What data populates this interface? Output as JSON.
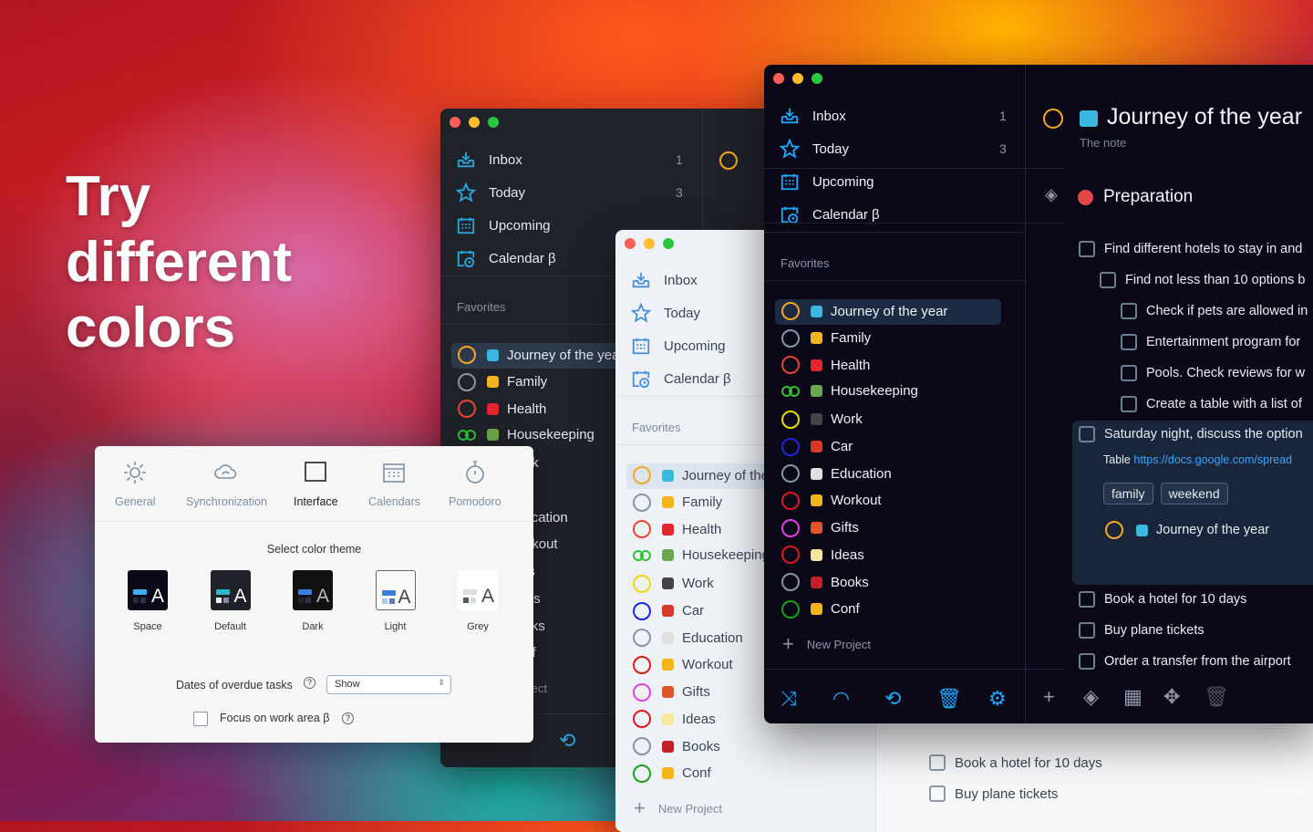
{
  "hero": {
    "line1": "Try",
    "line2": "different",
    "line3": "colors"
  },
  "nav": [
    {
      "label": "Inbox",
      "count": "1",
      "icon": "inbox-icon"
    },
    {
      "label": "Today",
      "count": "3",
      "icon": "star-icon"
    },
    {
      "label": "Upcoming",
      "count": "",
      "icon": "calendar-grid-icon"
    },
    {
      "label": "Calendar β",
      "count": "",
      "icon": "calendar-clock-icon"
    }
  ],
  "favorites_label": "Favorites",
  "new_project_label": "New Project",
  "projects": [
    {
      "name": "Journey of the year",
      "ring": "#f5a623",
      "emoji_color": "#3bb8e0"
    },
    {
      "name": "Family",
      "ring": "#8596a5",
      "emoji_color": "#f2b51f"
    },
    {
      "name": "Health",
      "ring": "#e8442f",
      "emoji_color": "#e4262e"
    },
    {
      "name": "Housekeeping",
      "ring": "#2fc42f",
      "double": true,
      "emoji_color": "#6aa84f"
    },
    {
      "name": "Work",
      "ring": "#e6dc00",
      "emoji_color": "#444"
    },
    {
      "name": "Car",
      "ring": "#1c24e6",
      "emoji_color": "#d83a2a"
    },
    {
      "name": "Education",
      "ring": "#8596a5",
      "emoji_color": "#e0e0e0"
    },
    {
      "name": "Workout",
      "ring": "#e01818",
      "emoji_color": "#f2b51f"
    },
    {
      "name": "Gifts",
      "ring": "#e33fe0",
      "emoji_color": "#e0562a"
    },
    {
      "name": "Ideas",
      "ring": "#e01818",
      "emoji_color": "#f5e6a0"
    },
    {
      "name": "Books",
      "ring": "#8596a5",
      "emoji_color": "#c2202a"
    },
    {
      "name": "Conf",
      "ring": "#18a018",
      "emoji_color": "#f2b51f"
    }
  ],
  "back_window": {
    "visible_partial": [
      "rk",
      "cation",
      "rkout",
      "s",
      "as",
      "oks",
      "nf",
      "oject"
    ]
  },
  "detail": {
    "project_title": "Journey of the year",
    "note": "The note",
    "heading": "Preparation",
    "tasks": [
      {
        "text": "Find different hotels to stay in and",
        "level": 0
      },
      {
        "text": "Find not less than 10 options b",
        "level": 1
      },
      {
        "text": "Check if pets are allowed in",
        "level": 2
      },
      {
        "text": "Entertainment program for",
        "level": 2
      },
      {
        "text": "Pools. Check reviews for w",
        "level": 2
      },
      {
        "text": "Create a table with a list of",
        "level": 2
      }
    ],
    "expanded_task": {
      "text": "Saturday night, discuss the option",
      "note_prefix": "Table",
      "link": "https://docs.google.com/spread",
      "tags": [
        "family",
        "weekend"
      ],
      "project": "Journey of the year"
    },
    "tasks_after": [
      "Book a hotel for 10 days",
      "Buy plane tickets",
      "Order a transfer from the airport"
    ]
  },
  "light_window": {
    "tasks": [
      "Book a hotel for 10 days",
      "Buy plane tickets"
    ]
  },
  "settings": {
    "tabs": [
      "General",
      "Synchronization",
      "Interface",
      "Calendars",
      "Pomodoro"
    ],
    "active_tab": "Interface",
    "section_title": "Select color theme",
    "themes": [
      "Space",
      "Default",
      "Dark",
      "Light",
      "Grey"
    ],
    "overdue_label": "Dates of overdue tasks",
    "overdue_value": "Show",
    "focus_label": "Focus on work area β"
  },
  "colors": {
    "space_bg": "#0b0818",
    "default_bg": "#1f2229",
    "light_bg": "#f4f6f8",
    "accent_space": "#1fa8ff"
  }
}
